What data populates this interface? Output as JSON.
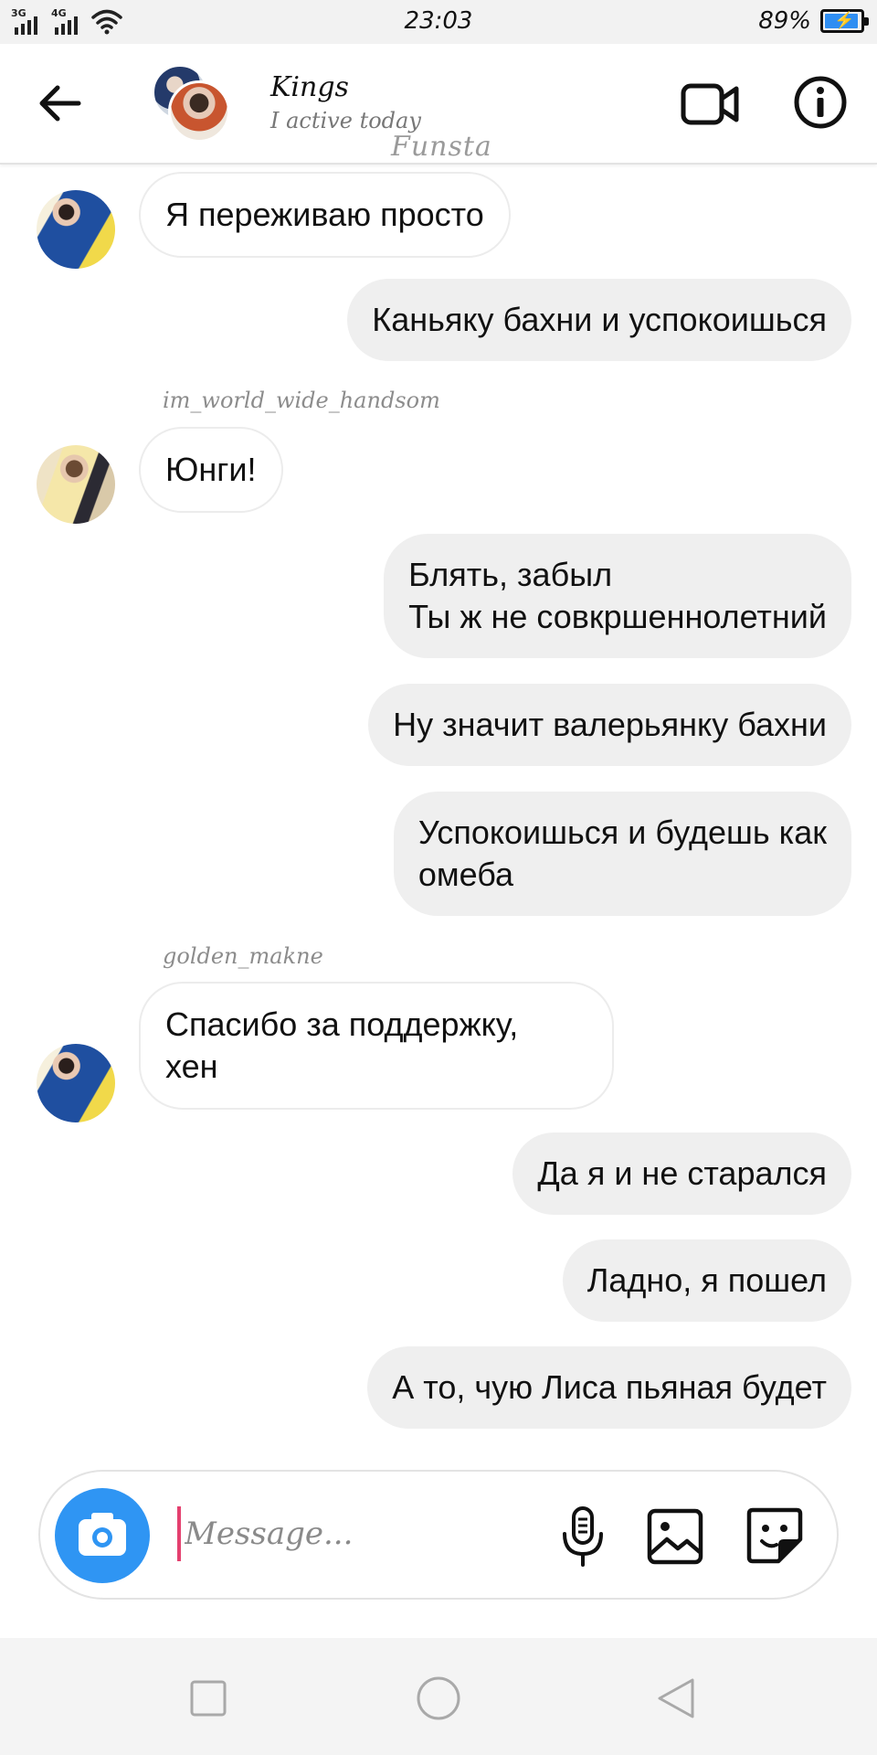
{
  "status_bar": {
    "network_1": "3G",
    "network_2": "4G",
    "time": "23:03",
    "battery_text": "89%",
    "battery_level": 0.89,
    "accent_color": "#2f8ef2"
  },
  "header": {
    "title": "Kings",
    "status": "I active today",
    "watermark": "Funsta",
    "icons": [
      "back-arrow-icon",
      "video-camera-icon",
      "info-icon"
    ]
  },
  "messages": [
    {
      "dir": "in",
      "text": "Я переживаю просто",
      "avatar": "sender-avatar-golden-makne"
    },
    {
      "dir": "out",
      "text": "Каньяку бахни и успокоишься"
    },
    {
      "dir": "in",
      "sender": "im_world_wide_handsom",
      "text": "Юнги!"
    },
    {
      "dir": "out",
      "text": "Блять, забыл\nТы ж не совкршеннолетний"
    },
    {
      "dir": "out",
      "text": "Ну значит валерьянку бахни"
    },
    {
      "dir": "out",
      "text": "Успокоишься и будешь как\nомеба"
    },
    {
      "dir": "in",
      "sender": "golden_makne",
      "text": "Спасибо за поддержку,\nхен"
    },
    {
      "dir": "out",
      "text": "Да я и не старался"
    },
    {
      "dir": "out",
      "text": "Ладно, я пошел"
    },
    {
      "dir": "out",
      "text": "А то, чую Лиса пьяная будет"
    }
  ],
  "composer": {
    "placeholder": "Message...",
    "value": "",
    "camera_color": "#2f95f3",
    "icons": [
      "camera-icon",
      "microphone-icon",
      "gallery-icon",
      "sticker-icon"
    ]
  },
  "nav_bar": {
    "icons": [
      "recent-apps-icon",
      "home-icon",
      "back-icon"
    ]
  }
}
